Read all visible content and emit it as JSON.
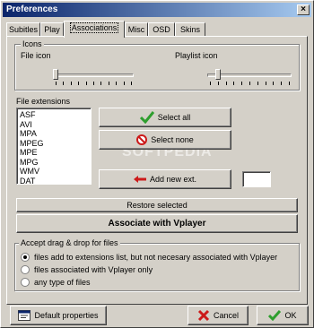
{
  "window": {
    "title": "Preferences",
    "close_glyph": "×"
  },
  "tabs": [
    {
      "label": "Subitles",
      "active": false
    },
    {
      "label": "Play",
      "active": false
    },
    {
      "label": "Associations",
      "active": true
    },
    {
      "label": "Misc",
      "active": false
    },
    {
      "label": "OSD",
      "active": false
    },
    {
      "label": "Skins",
      "active": false
    }
  ],
  "icons_group": {
    "title": "Icons",
    "file_icon_label": "File icon",
    "playlist_icon_label": "Playlist icon",
    "file_icon_value": 0,
    "playlist_icon_value": 0.1
  },
  "extensions": {
    "label": "File extensions",
    "items": [
      "ASF",
      "AVI",
      "MPA",
      "MPEG",
      "MPE",
      "MPG",
      "WMV",
      "DAT"
    ]
  },
  "buttons": {
    "select_all": "Select all",
    "select_none": "Select none",
    "add_new_ext": "Add new ext.",
    "restore_selected": "Restore selected",
    "associate": "Associate with Vplayer",
    "default_properties": "Default properties",
    "cancel": "Cancel",
    "ok": "OK"
  },
  "new_ext_value": "",
  "drag_drop": {
    "title": "Accept drag & drop for files",
    "options": [
      "files add to extensions list, but not necesary associated with Vplayer",
      "files associated with Vplayer only",
      "any type of files"
    ],
    "selected_index": 0
  },
  "watermark": "SOFTPEDIA",
  "colors": {
    "titlebar_start": "#0a246a",
    "titlebar_end": "#a6caf0",
    "check_green": "#2e9e2e",
    "cross_red": "#cc1a1a"
  }
}
